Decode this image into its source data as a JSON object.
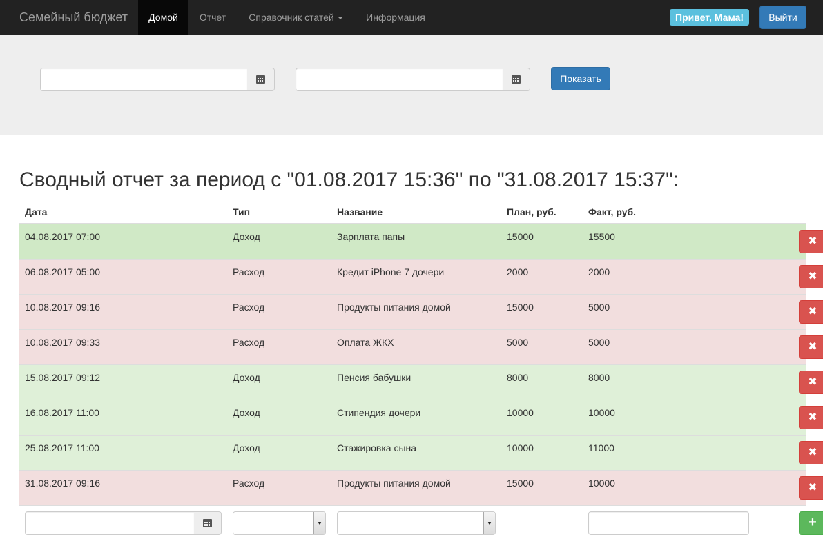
{
  "navbar": {
    "brand": "Семейный бюджет",
    "items": [
      {
        "label": "Домой",
        "active": true
      },
      {
        "label": "Отчет",
        "active": false
      },
      {
        "label": "Справочник статей",
        "active": false,
        "dropdown": true
      },
      {
        "label": "Информация",
        "active": false
      }
    ],
    "greeting": "Привет, Мама!",
    "logout_label": "Выйти"
  },
  "filter": {
    "date_from": "",
    "date_to": "",
    "show_label": "Показать"
  },
  "report": {
    "title": "Сводный отчет за период с \"01.08.2017 15:36\" по \"31.08.2017 15:37\":",
    "columns": [
      "Дата",
      "Тип",
      "Название",
      "План, руб.",
      "Факт, руб."
    ],
    "rows": [
      {
        "date": "04.08.2017 07:00",
        "type": "Доход",
        "name": "Зарплата папы",
        "plan": "15000",
        "fact": "15500",
        "kind": "income"
      },
      {
        "date": "06.08.2017 05:00",
        "type": "Расход",
        "name": "Кредит iPhone 7 дочери",
        "plan": "2000",
        "fact": "2000",
        "kind": "expense"
      },
      {
        "date": "10.08.2017 09:16",
        "type": "Расход",
        "name": "Продукты питания домой",
        "plan": "15000",
        "fact": "5000",
        "kind": "expense"
      },
      {
        "date": "10.08.2017 09:33",
        "type": "Расход",
        "name": "Оплата ЖКХ",
        "plan": "5000",
        "fact": "5000",
        "kind": "expense"
      },
      {
        "date": "15.08.2017 09:12",
        "type": "Доход",
        "name": "Пенсия бабушки",
        "plan": "8000",
        "fact": "8000",
        "kind": "income"
      },
      {
        "date": "16.08.2017 11:00",
        "type": "Доход",
        "name": "Стипендия дочери",
        "plan": "10000",
        "fact": "10000",
        "kind": "income"
      },
      {
        "date": "25.08.2017 11:00",
        "type": "Доход",
        "name": "Стажировка сына",
        "plan": "10000",
        "fact": "11000",
        "kind": "income"
      },
      {
        "date": "31.08.2017 09:16",
        "type": "Расход",
        "name": "Продукты питания домой",
        "plan": "15000",
        "fact": "10000",
        "kind": "expense"
      }
    ],
    "delete_glyph": "✖",
    "add_glyph": "+"
  },
  "colors": {
    "navbar_bg": "#222222",
    "primary": "#337ab7",
    "info": "#5bc0de",
    "income_row": "#dff0d8",
    "expense_row": "#f2dede",
    "danger": "#d9534f",
    "success": "#5cb85c"
  },
  "icons": {
    "calendar": "calendar-icon",
    "delete": "remove-icon",
    "add": "plus-icon",
    "select": "chevron-down-icon"
  }
}
